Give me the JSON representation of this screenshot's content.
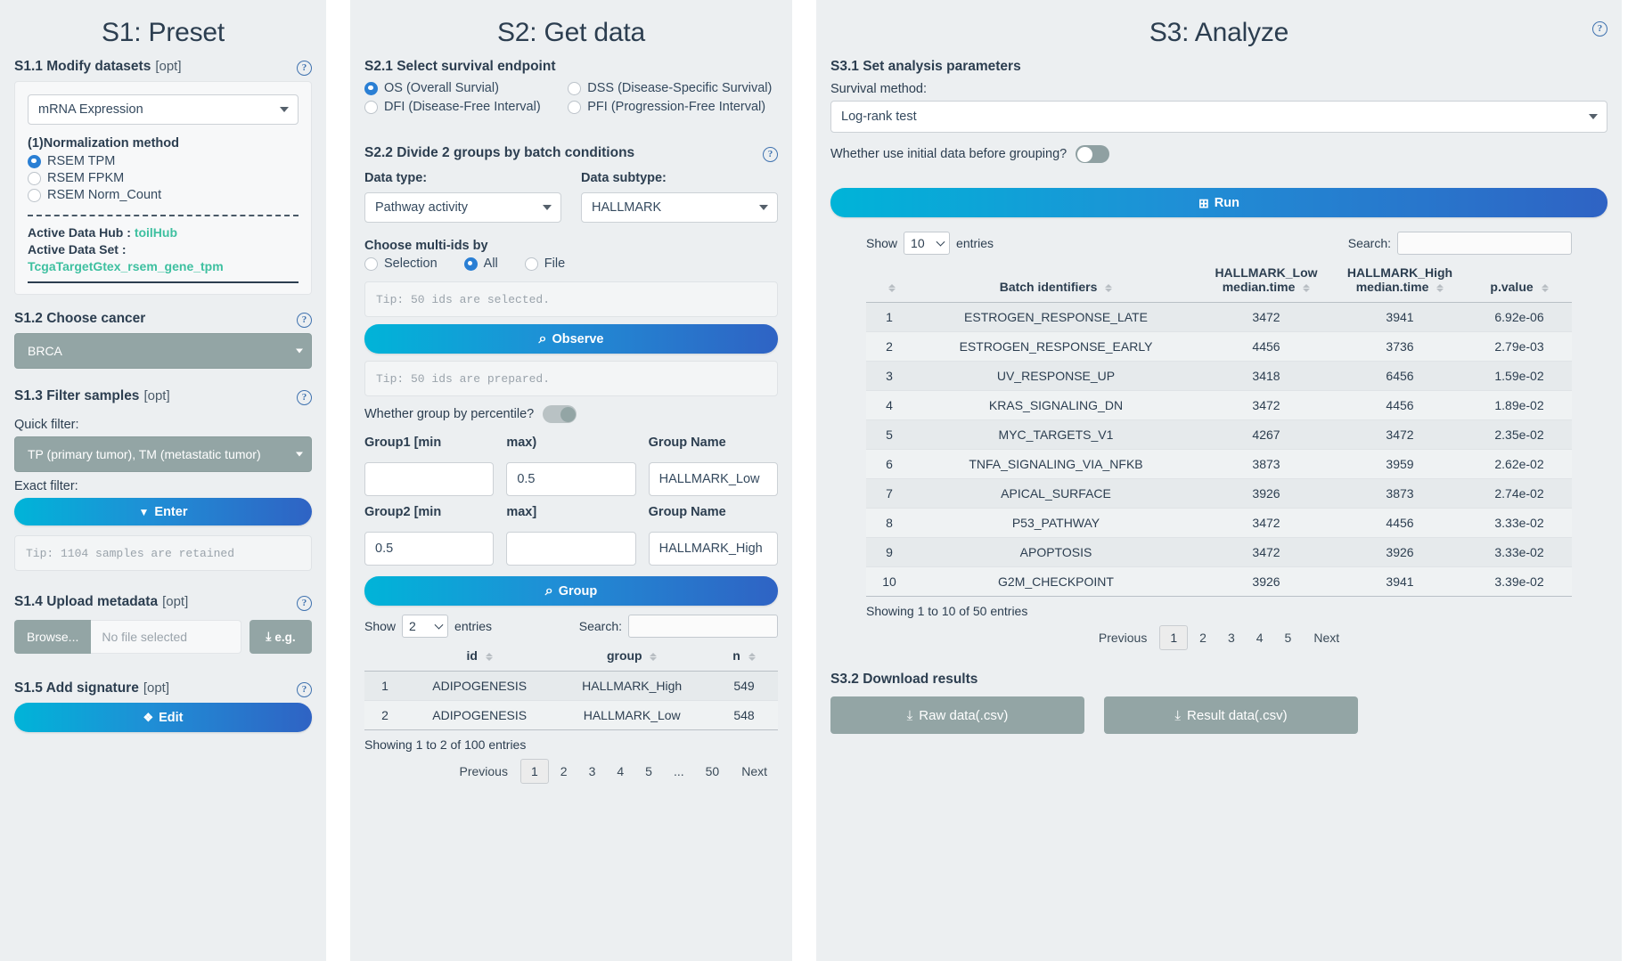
{
  "panel1": {
    "title": "S1: Preset",
    "s1_1": {
      "heading": "S1.1 Modify datasets",
      "opt": "[opt]",
      "dataset_select": "mRNA Expression",
      "norm_label": "(1)Normalization method",
      "norm_options": [
        "RSEM TPM",
        "RSEM FPKM",
        "RSEM Norm_Count"
      ],
      "norm_selected": "RSEM TPM",
      "active_hub_key": "Active Data Hub :",
      "active_hub_value": "toilHub",
      "active_set_key": "Active Data Set :",
      "active_set_value": "TcgaTargetGtex_rsem_gene_tpm"
    },
    "s1_2": {
      "heading": "S1.2 Choose cancer",
      "cancer_select": "BRCA"
    },
    "s1_3": {
      "heading": "S1.3 Filter samples",
      "opt": "[opt]",
      "quick_filter_label": "Quick filter:",
      "quick_filter_value": "TP (primary tumor), TM (metastatic tumor)",
      "exact_filter_label": "Exact filter:",
      "enter_button": "Enter",
      "tip": "Tip: 1104 samples are retained"
    },
    "s1_4": {
      "heading": "S1.4 Upload metadata",
      "opt": "[opt]",
      "browse_label": "Browse...",
      "file_name": "No file selected",
      "eg_label": "e.g."
    },
    "s1_5": {
      "heading": "S1.5 Add signature",
      "opt": "[opt]",
      "edit_button": "Edit"
    }
  },
  "panel2": {
    "title": "S2: Get data",
    "s2_1": {
      "heading": "S2.1 Select survival endpoint",
      "options": [
        "OS (Overall Survial)",
        "DSS (Disease-Specific Survival)",
        "DFI (Disease-Free Interval)",
        "PFI (Progression-Free Interval)"
      ],
      "selected": "OS (Overall Survial)"
    },
    "s2_2": {
      "heading": "S2.2 Divide 2 groups by batch conditions",
      "data_type_label": "Data type:",
      "data_type_value": "Pathway activity",
      "data_subtype_label": "Data subtype:",
      "data_subtype_value": "HALLMARK",
      "choose_label": "Choose multi-ids by",
      "choose_options": [
        "Selection",
        "All",
        "File"
      ],
      "choose_selected": "All",
      "tip_selected": "Tip: 50 ids are selected.",
      "observe_button": "Observe",
      "tip_prepared": "Tip: 50 ids are prepared.",
      "percentile_label": "Whether group by percentile?",
      "group1_min_label": "Group1 [min",
      "group1_min_value": "",
      "group1_max_label": "max)",
      "group1_max_value": "0.5",
      "group1_name_label": "Group Name",
      "group1_name_value": "HALLMARK_Low",
      "group2_min_label": "Group2 [min",
      "group2_min_value": "0.5",
      "group2_max_label": "max]",
      "group2_max_value": "",
      "group2_name_label": "Group Name",
      "group2_name_value": "HALLMARK_High",
      "group_button": "Group"
    },
    "table": {
      "show_label": "Show",
      "entries_label": "entries",
      "page_size": "2",
      "search_label": "Search:",
      "search_value": "",
      "columns": [
        "id",
        "group",
        "n"
      ],
      "rows": [
        {
          "idx": "1",
          "id": "ADIPOGENESIS",
          "group": "HALLMARK_High",
          "n": "549"
        },
        {
          "idx": "2",
          "id": "ADIPOGENESIS",
          "group": "HALLMARK_Low",
          "n": "548"
        }
      ],
      "footer": "Showing 1 to 2 of 100 entries",
      "pager": [
        "Previous",
        "1",
        "2",
        "3",
        "4",
        "5",
        "...",
        "50",
        "Next"
      ],
      "active_page": "1"
    }
  },
  "panel3": {
    "title": "S3: Analyze",
    "s3_1": {
      "heading": "S3.1 Set analysis parameters",
      "method_label": "Survival method:",
      "method_value": "Log-rank test",
      "initial_data_label": "Whether use initial data before grouping?",
      "run_button": "Run"
    },
    "table": {
      "show_label": "Show",
      "entries_label": "entries",
      "page_size": "10",
      "search_label": "Search:",
      "search_value": "",
      "columns": [
        "Batch identifiers",
        "HALLMARK_Low\nmedian.time",
        "HALLMARK_High\nmedian.time",
        "p.value"
      ],
      "col0": "Batch identifiers",
      "col1_l1": "HALLMARK_Low",
      "col1_l2": "median.time",
      "col2_l1": "HALLMARK_High",
      "col2_l2": "median.time",
      "col3": "p.value",
      "rows": [
        {
          "idx": "1",
          "name": "ESTROGEN_RESPONSE_LATE",
          "low": "3472",
          "high": "3941",
          "p": "6.92e-06"
        },
        {
          "idx": "2",
          "name": "ESTROGEN_RESPONSE_EARLY",
          "low": "4456",
          "high": "3736",
          "p": "2.79e-03"
        },
        {
          "idx": "3",
          "name": "UV_RESPONSE_UP",
          "low": "3418",
          "high": "6456",
          "p": "1.59e-02"
        },
        {
          "idx": "4",
          "name": "KRAS_SIGNALING_DN",
          "low": "3472",
          "high": "4456",
          "p": "1.89e-02"
        },
        {
          "idx": "5",
          "name": "MYC_TARGETS_V1",
          "low": "4267",
          "high": "3472",
          "p": "2.35e-02"
        },
        {
          "idx": "6",
          "name": "TNFA_SIGNALING_VIA_NFKB",
          "low": "3873",
          "high": "3959",
          "p": "2.62e-02"
        },
        {
          "idx": "7",
          "name": "APICAL_SURFACE",
          "low": "3926",
          "high": "3873",
          "p": "2.74e-02"
        },
        {
          "idx": "8",
          "name": "P53_PATHWAY",
          "low": "3472",
          "high": "4456",
          "p": "3.33e-02"
        },
        {
          "idx": "9",
          "name": "APOPTOSIS",
          "low": "3472",
          "high": "3926",
          "p": "3.33e-02"
        },
        {
          "idx": "10",
          "name": "G2M_CHECKPOINT",
          "low": "3926",
          "high": "3941",
          "p": "3.39e-02"
        }
      ],
      "footer": "Showing 1 to 10 of 50 entries",
      "pager": [
        "Previous",
        "1",
        "2",
        "3",
        "4",
        "5",
        "Next"
      ],
      "active_page": "1"
    },
    "s3_2": {
      "heading": "S3.2 Download results",
      "raw_button": "Raw data(.csv)",
      "result_button": "Result data(.csv)"
    }
  },
  "icons": {
    "help": "?",
    "search": "⌕",
    "filter": "▼",
    "edit": "❖",
    "download": "⤓",
    "grid": "⊞"
  },
  "colors": {
    "panel_bg": "#eceff1",
    "accent_blue": "#1f8fd6",
    "accent_cyan": "#00b4d8",
    "accent_teal": "#3ec0a0",
    "grey_control": "#93a5a5"
  }
}
